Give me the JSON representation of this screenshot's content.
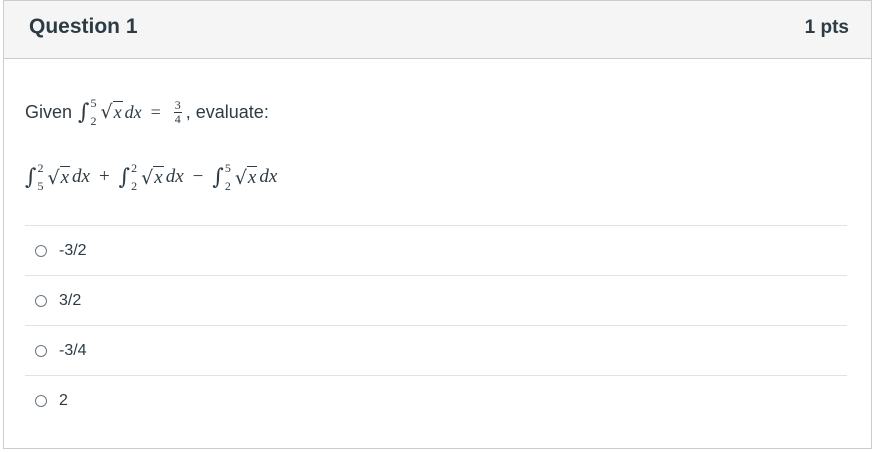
{
  "header": {
    "title": "Question 1",
    "points": "1 pts"
  },
  "prompt": {
    "given_label": "Given",
    "given_lower": "2",
    "given_upper": "5",
    "integrand": "x",
    "differential": "dx",
    "equals": "=",
    "frac_num": "3",
    "frac_den": "4",
    "evaluate_label": ", evaluate:"
  },
  "expression": {
    "terms": [
      {
        "lower": "5",
        "upper": "2",
        "operator_after": "+"
      },
      {
        "lower": "2",
        "upper": "2",
        "operator_after": "−"
      },
      {
        "lower": "2",
        "upper": "5",
        "operator_after": ""
      }
    ],
    "integrand": "x",
    "differential": "dx"
  },
  "answers": [
    {
      "label": "-3/2"
    },
    {
      "label": "3/2"
    },
    {
      "label": "-3/4"
    },
    {
      "label": "2"
    }
  ]
}
